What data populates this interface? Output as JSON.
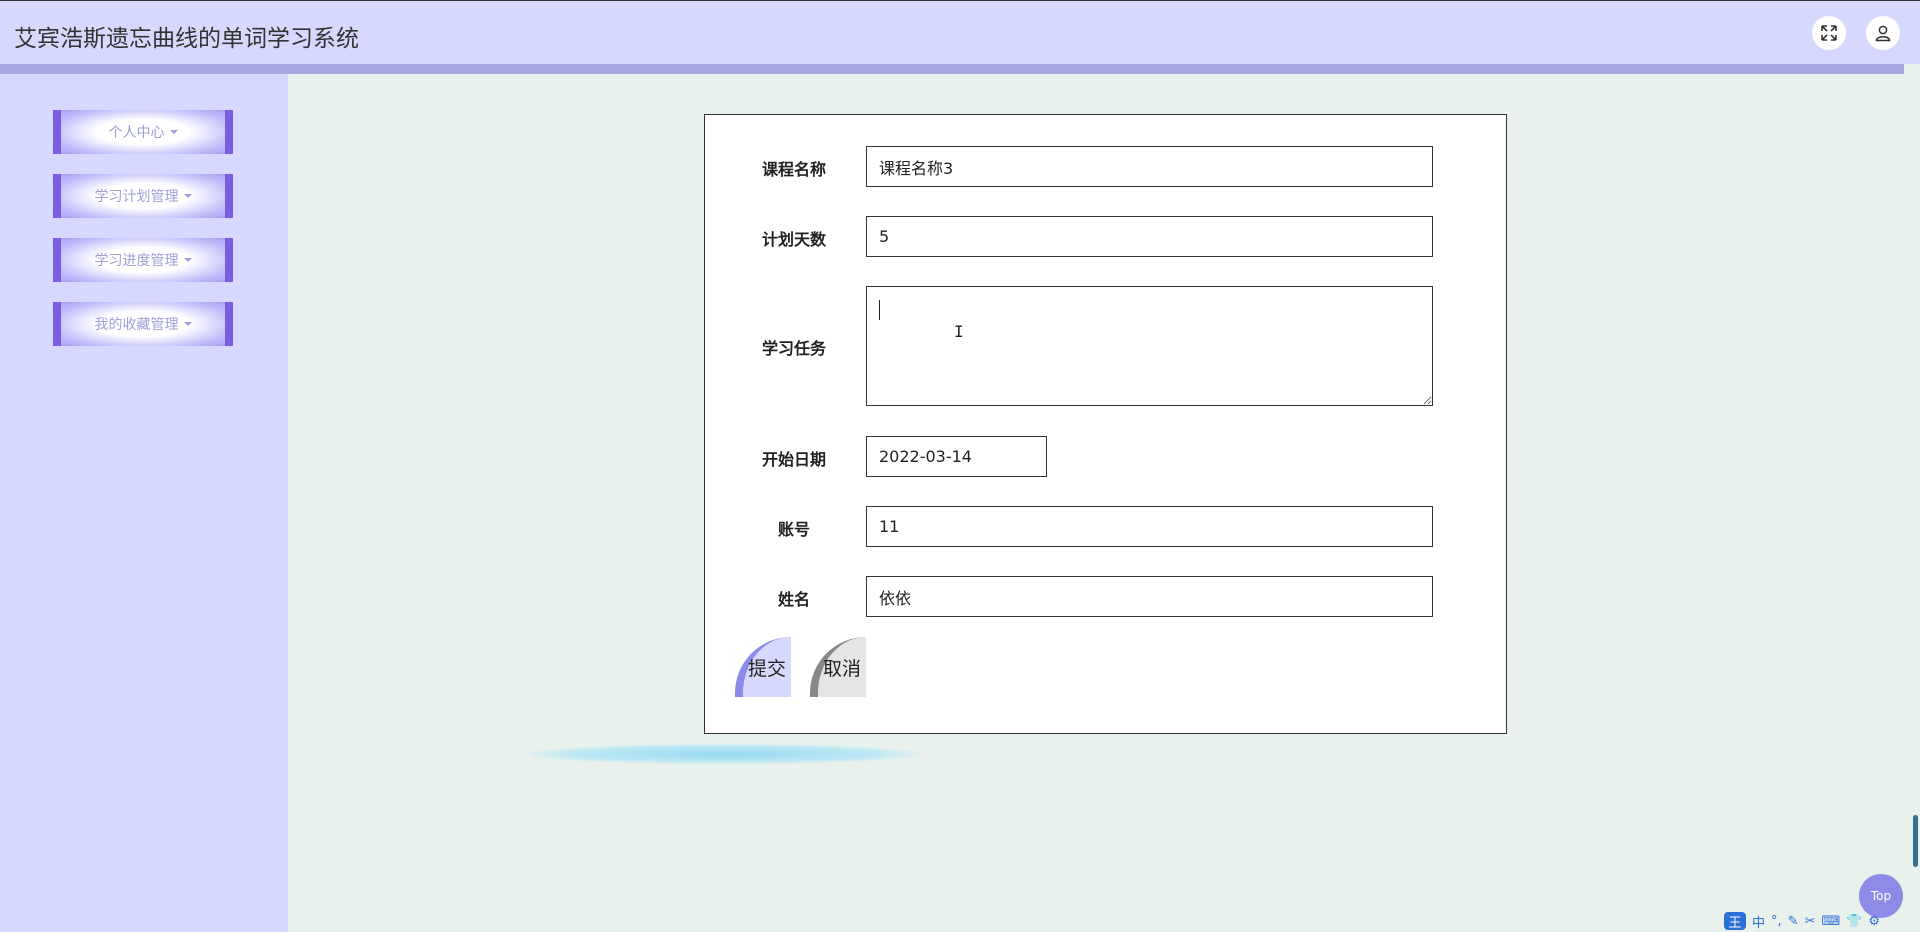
{
  "header": {
    "title": "艾宾浩斯遗忘曲线的单词学习系统",
    "fullscreen_icon": "expand-arrows-icon",
    "user_icon": "user-icon"
  },
  "sidebar": {
    "items": [
      {
        "label": "个人中心"
      },
      {
        "label": "学习计划管理"
      },
      {
        "label": "学习进度管理"
      },
      {
        "label": "我的收藏管理"
      }
    ]
  },
  "form": {
    "course_name": {
      "label": "课程名称",
      "value": "课程名称3"
    },
    "plan_days": {
      "label": "计划天数",
      "value": "5"
    },
    "study_task": {
      "label": "学习任务",
      "value": ""
    },
    "start_date": {
      "label": "开始日期",
      "value": "2022-03-14"
    },
    "account": {
      "label": "账号",
      "value": "11"
    },
    "name": {
      "label": "姓名",
      "value": "依依"
    },
    "submit_label": "提交",
    "cancel_label": "取消"
  },
  "top_button": {
    "label": "Top"
  },
  "ime": {
    "logo": "王",
    "items": [
      "中",
      "°,",
      "✎",
      "✂",
      "⌨",
      "👕",
      "⚙"
    ]
  },
  "colors": {
    "header_bg": "#d7d8fe",
    "accent": "#7b5ce0",
    "page_bg": "#e8f1ec"
  }
}
